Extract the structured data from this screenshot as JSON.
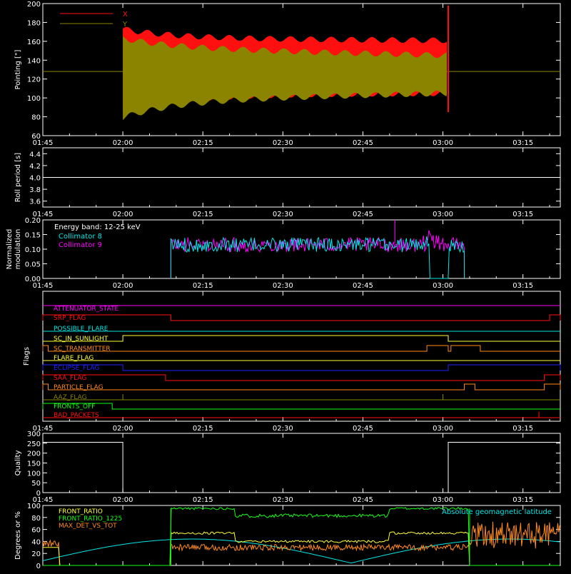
{
  "time_ticks": [
    "01:45",
    "02:00",
    "02:15",
    "02:30",
    "02:45",
    "03:00",
    "03:15"
  ],
  "colors": {
    "frame": "#ffffff",
    "red": "#ff1010",
    "olive": "#8a8400",
    "magenta": "#ff00ff",
    "cyan": "#00e6e6",
    "orange": "#ff8a1a",
    "yellow": "#ffff33",
    "blue": "#2020ff",
    "green": "#10ff10"
  },
  "chart_data": [
    {
      "type": "area",
      "ylabel": "Pointing [\"]",
      "ylim": [
        60,
        200
      ],
      "yticks": [
        60,
        80,
        100,
        120,
        140,
        160,
        180,
        200
      ],
      "xlim": [
        "01:45",
        "03:22"
      ],
      "legend": "top-left",
      "series": [
        {
          "name": "X",
          "color": "#ff1010",
          "start": "02:00",
          "end": "03:01",
          "center": 133,
          "amplitude_start": 30,
          "amplitude_end": 28
        },
        {
          "name": "Y",
          "color": "#8a8400",
          "start": "02:00",
          "end": "03:01",
          "center": 125,
          "amplitude_start": 28,
          "amplitude_end": 20
        }
      ],
      "baseline_y": 128,
      "end_spike_y": [
        85,
        198
      ]
    },
    {
      "type": "line",
      "ylabel": "Roll period [s]",
      "ylim": [
        3.5,
        4.5
      ],
      "yticks": [
        "3.6",
        "3.8",
        "4.0",
        "4.2",
        "4.4"
      ],
      "constant_value": 4.0
    },
    {
      "type": "line",
      "ylabel": "Normalized modulation",
      "ylim": [
        0,
        0.2
      ],
      "yticks": [
        "0.00",
        "0.05",
        "0.10",
        "0.15",
        "0.20"
      ],
      "annotation": "Energy band: 12-25 keV",
      "legend": "top-left",
      "series": [
        {
          "name": "Collimator 8",
          "color": "#00e6e6",
          "start": "02:09",
          "end": "03:04",
          "mean": 0.115
        },
        {
          "name": "Collimator 9",
          "color": "#ff00ff",
          "start": "02:09",
          "end": "03:04",
          "mean": 0.115
        }
      ]
    },
    {
      "type": "line",
      "ylabel": "Flags",
      "flags": [
        {
          "name": "ATTENUATOR_STATE",
          "color": "#ff00ff"
        },
        {
          "name": "SRP_FLAG",
          "color": "#ff1010"
        },
        {
          "name": "POSSIBLE_FLARE",
          "color": "#00e6e6"
        },
        {
          "name": "SC_IN_SUNLIGHT",
          "color": "#ffff33"
        },
        {
          "name": "SC_TRANSMITTER",
          "color": "#ff8a1a"
        },
        {
          "name": "FLARE_FLAG",
          "color": "#ffff33"
        },
        {
          "name": "ECLIPSE_FLAG",
          "color": "#2020ff"
        },
        {
          "name": "SAA_FLAG",
          "color": "#ff1010"
        },
        {
          "name": "PARTICLE_FLAG",
          "color": "#ff8a1a"
        },
        {
          "name": "AAZ_FLAG",
          "color": "#8a8400"
        },
        {
          "name": "FRONTS_OFF",
          "color": "#10ff10"
        },
        {
          "name": "BAD_PACKETS",
          "color": "#ff1010"
        }
      ]
    },
    {
      "type": "line",
      "ylabel": "Quality",
      "ylim": [
        0,
        300
      ],
      "yticks": [
        0,
        50,
        100,
        150,
        200,
        250,
        300
      ],
      "segments": [
        {
          "start": "01:45",
          "end": "02:00",
          "value": 255
        },
        {
          "start": "03:01",
          "end": "03:22",
          "value": 255
        }
      ]
    },
    {
      "type": "line",
      "ylabel": "Degrees or %",
      "ylim": [
        0,
        100
      ],
      "yticks": [
        0,
        20,
        40,
        60,
        80,
        100
      ],
      "legend": "top-left",
      "series": [
        {
          "name": "FRONT_RATIO",
          "color": "#ffff33",
          "level": 52
        },
        {
          "name": "FRONT_RATIO_1225",
          "color": "#10ff10",
          "level": 90
        },
        {
          "name": "MAX_DET_VS_TOT",
          "color": "#ff8a1a",
          "level": 28
        },
        {
          "name": "Absolute geomagnetic latitude",
          "color": "#00e6e6",
          "peak": 45
        }
      ]
    }
  ]
}
